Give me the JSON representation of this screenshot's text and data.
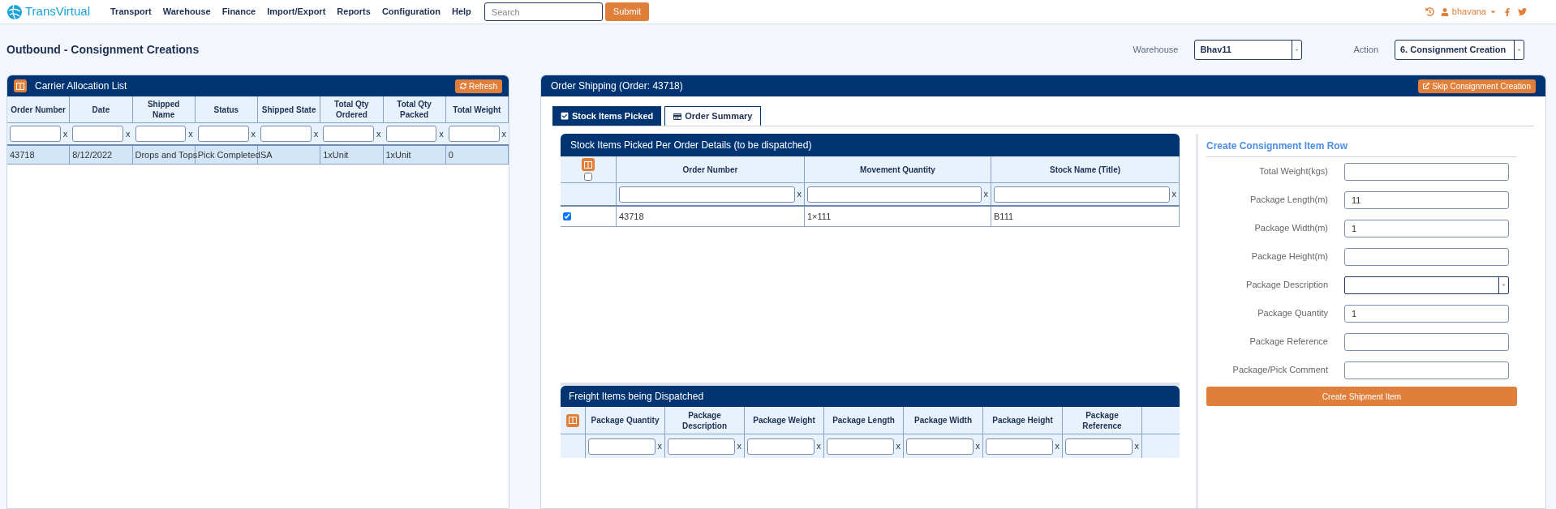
{
  "navbar": {
    "brand": "TransVirtual",
    "menu": [
      "Transport",
      "Warehouse",
      "Finance",
      "Import/Export",
      "Reports",
      "Configuration",
      "Help"
    ],
    "search": {
      "placeholder": "Search"
    },
    "submit": "Submit",
    "user": "bhavana"
  },
  "page_title": "Outbound - Consignment Creations",
  "selectors": [
    {
      "label": "Warehouse",
      "value": "Bhav11"
    },
    {
      "label": "Action",
      "value": "6. Consignment Creation"
    }
  ],
  "carrier_list": {
    "title": "Carrier Allocation List",
    "refresh": "Refresh",
    "columns": [
      {
        "label": "Order Number",
        "clear": "x"
      },
      {
        "label": "Date",
        "clear": "x"
      },
      {
        "label": "Shipped Name",
        "clear": "x"
      },
      {
        "label": "Status",
        "clear": "x"
      },
      {
        "label": "Shipped State",
        "clear": "x"
      },
      {
        "label": "Total Qty Ordered",
        "clear": "x"
      },
      {
        "label": "Total Qty Packed",
        "clear": "x"
      },
      {
        "label": "Total Weight",
        "clear": "x"
      }
    ],
    "rows": [
      {
        "selected": true,
        "cells": [
          "43718",
          "8/12/2022",
          "Drops and Tops",
          "Pick Completed",
          "SA",
          "1xUnit",
          "1xUnit",
          "0"
        ]
      }
    ]
  },
  "order_shipping": {
    "title": "Order Shipping (Order: 43718)",
    "skip": "Skip Consignment Creation",
    "tabs": [
      {
        "label": "Stock Items Picked",
        "selected": true
      },
      {
        "label": "Order Summary",
        "selected": false
      }
    ],
    "stock_table": {
      "title": "Stock Items Picked Per Order Details (to be dispatched)",
      "select_all_checked": false,
      "columns": [
        {
          "label": "Order Number",
          "clear": "x"
        },
        {
          "label": "Movement Quantity",
          "clear": "x"
        },
        {
          "label": "Stock Name (Title)",
          "clear": "x"
        }
      ],
      "rows": [
        {
          "checked": true,
          "cells": [
            "43718",
            "1×111",
            "B111"
          ]
        }
      ]
    },
    "freight_table": {
      "title": "Freight Items being Dispatched",
      "columns": [
        {
          "label": "Package Quantity",
          "clear": "x"
        },
        {
          "label": "Package Description",
          "clear": "x"
        },
        {
          "label": "Package Weight",
          "clear": "x"
        },
        {
          "label": "Package Length",
          "clear": "x"
        },
        {
          "label": "Package Width",
          "clear": "x"
        },
        {
          "label": "Package Height",
          "clear": "x"
        },
        {
          "label": "Package Reference",
          "clear": "x"
        }
      ]
    },
    "form": {
      "title": "Create Consignment Item Row",
      "fields": [
        {
          "kind": "text",
          "label": "Total Weight(kgs)"
        },
        {
          "kind": "text",
          "label": "Package Length(m)",
          "value": "11"
        },
        {
          "kind": "text",
          "label": "Package Width(m)",
          "value": "1"
        },
        {
          "kind": "text",
          "label": "Package Height(m)"
        },
        {
          "kind": "select",
          "label": "Package Description"
        },
        {
          "kind": "text",
          "label": "Package Quantity",
          "value": "1"
        },
        {
          "kind": "text",
          "label": "Package Reference"
        },
        {
          "kind": "text",
          "label": "Package/Pick Comment"
        }
      ],
      "button": "Create Shipment Item"
    }
  }
}
